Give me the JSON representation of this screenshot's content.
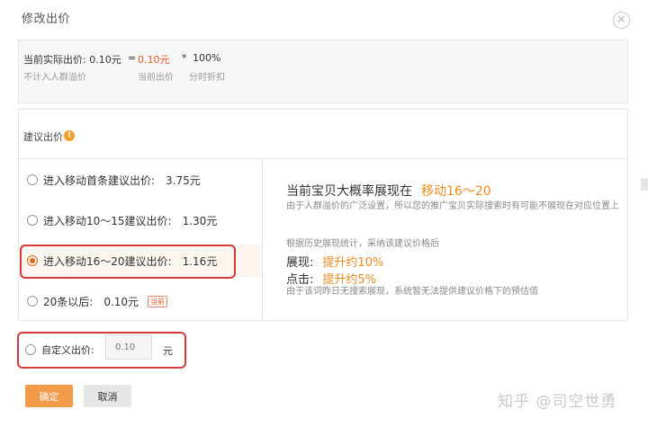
{
  "dialog": {
    "title": "修改出价"
  },
  "current_price": {
    "label": "当前实际出价:",
    "value": "0.10元",
    "equals": "=",
    "bid": "0.10元",
    "times": "*",
    "discount": "100%",
    "sub_left": "不计入人群溢价",
    "sub_mid": "当前出价",
    "sub_right": "分时折扣"
  },
  "suggested": {
    "label": "建议出价",
    "info_glyph": "!",
    "options": [
      {
        "label": "进入移动首条建议出价:",
        "value": "3.75元",
        "selected": false
      },
      {
        "label": "进入移动10～15建议出价:",
        "value": "1.30元",
        "selected": false
      },
      {
        "label": "进入移动16～20建议出价:",
        "value": "1.16元",
        "selected": true
      },
      {
        "label": "20条以后:",
        "value": "0.10元",
        "badge": "当前",
        "selected": false
      }
    ]
  },
  "detail": {
    "headline": "当前宝贝大概率展现在",
    "headline_highlight": "移动16～20",
    "desc1": "由于人群溢价的广泛设置，所以您的推广宝贝实际搜索时有可能不展现在对应位置上",
    "desc2": "根据历史展现统计，采纳该建议价格后",
    "impression_label": "展现:",
    "impression_value": "提升约10%",
    "click_label": "点击:",
    "click_value": "提升约5%",
    "desc3": "由于该词昨日无搜索展现，系统暂无法提供建议价格下的预估值"
  },
  "custom_bid": {
    "label": "自定义出价:",
    "placeholder": "0.10",
    "unit": "元"
  },
  "buttons": {
    "confirm": "确定",
    "cancel": "取消"
  },
  "watermark": "知乎 @司空世勇",
  "colors": {
    "accent": "#f08a1c",
    "confirm_bg": "#f29a4a",
    "highlight_box": "#d8393a"
  }
}
